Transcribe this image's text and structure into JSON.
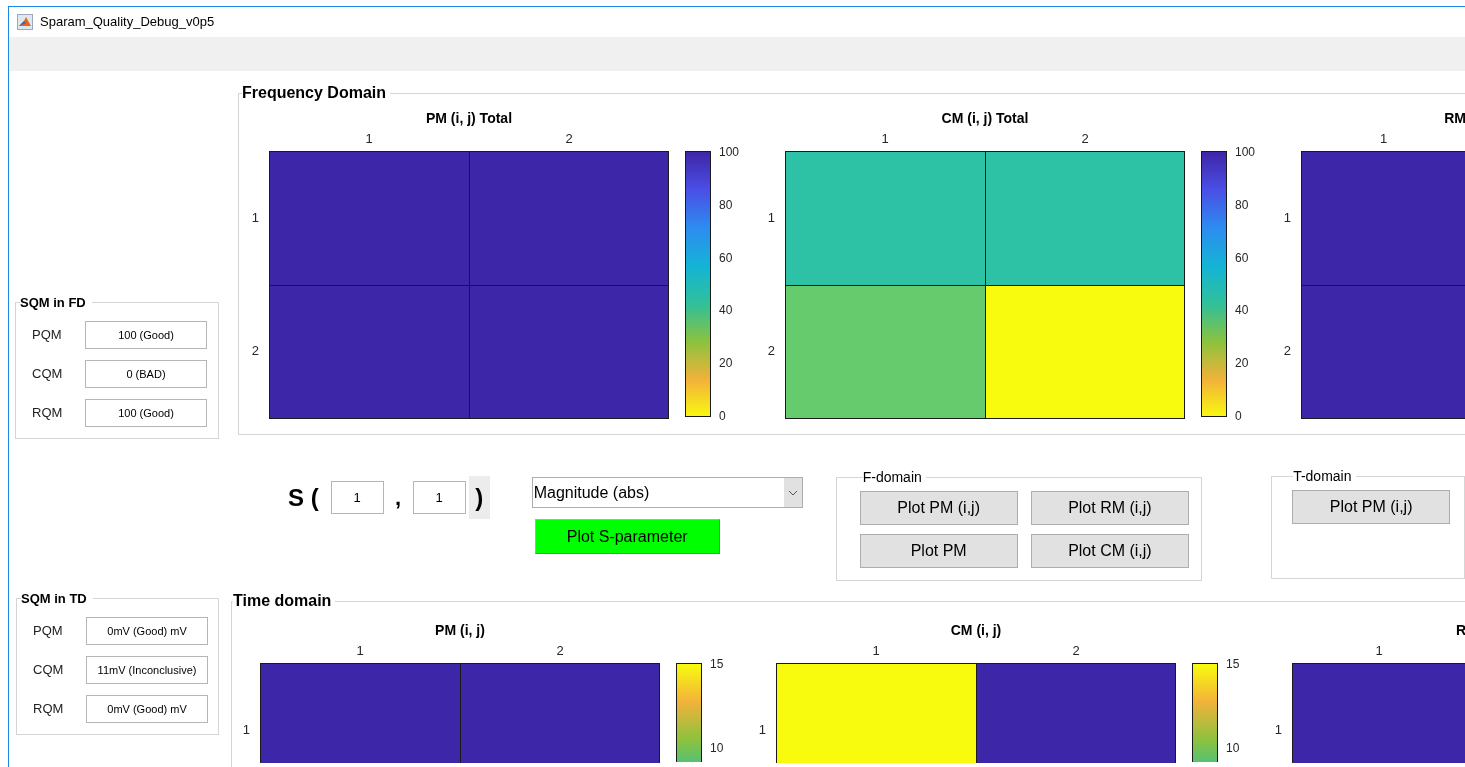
{
  "window": {
    "title": "Sparam_Quality_Debug_v0p5"
  },
  "sqm_fd": {
    "title": "SQM in FD",
    "rows": [
      {
        "label": "PQM",
        "value": "100 (Good)"
      },
      {
        "label": "CQM",
        "value": "0 (BAD)"
      },
      {
        "label": "RQM",
        "value": "100 (Good)"
      }
    ]
  },
  "frequency_domain": {
    "title": "Frequency Domain",
    "heatmaps": [
      {
        "title": "PM (i, j) Total",
        "columns": [
          "1",
          "2"
        ],
        "rows": [
          {
            "label": "1",
            "cells": [
              {
                "color": "#3e26a8"
              },
              {
                "color": "#3e26a8"
              }
            ]
          },
          {
            "label": "2",
            "cells": [
              {
                "color": "#3e26a8"
              },
              {
                "color": "#3e26a8"
              }
            ]
          }
        ],
        "colorbar": {
          "ascending": true,
          "ticks": [
            "100",
            "80",
            "60",
            "40",
            "20",
            "0"
          ]
        }
      },
      {
        "title": "CM (i, j) Total",
        "columns": [
          "1",
          "2"
        ],
        "rows": [
          {
            "label": "1",
            "cells": [
              {
                "color": "#2dc2a5"
              },
              {
                "color": "#2dc2a5"
              }
            ]
          },
          {
            "label": "2",
            "cells": [
              {
                "color": "#65cb6d"
              },
              {
                "color": "#f9fb0e"
              }
            ]
          }
        ],
        "colorbar": {
          "ascending": true,
          "ticks": [
            "100",
            "80",
            "60",
            "40",
            "20",
            "0"
          ]
        }
      },
      {
        "title": "RM",
        "columns": [
          "1"
        ],
        "rows": [
          {
            "label": "1",
            "cells": [
              {
                "color": "#3e26a8"
              }
            ]
          },
          {
            "label": "2",
            "cells": [
              {
                "color": "#3e26a8"
              }
            ]
          }
        ]
      }
    ]
  },
  "s_selector": {
    "label": "S (",
    "row": "1",
    "separator": ",",
    "column": "1",
    "close": ")"
  },
  "display": {
    "value": "Magnitude (abs)"
  },
  "plot_button": "Plot S-parameter",
  "f_domain": {
    "title": "F-domain",
    "buttons": [
      "Plot PM (i,j)",
      "Plot RM (i,j)",
      "Plot PM",
      "Plot CM (i,j)"
    ]
  },
  "t_domain": {
    "title": "T-domain",
    "buttons": [
      "Plot PM (i,j)"
    ]
  },
  "sqm_td": {
    "title": "SQM in TD",
    "rows": [
      {
        "label": "PQM",
        "value": "0mV (Good) mV"
      },
      {
        "label": "CQM",
        "value": "11mV (Inconclusive)"
      },
      {
        "label": "RQM",
        "value": "0mV (Good) mV"
      }
    ]
  },
  "time_domain": {
    "title": "Time domain",
    "heatmaps": [
      {
        "title": "PM (i, j)",
        "columns": [
          "1",
          "2"
        ],
        "rows": [
          {
            "label": "1",
            "cells": [
              {
                "color": "#3e26a8"
              },
              {
                "color": "#3e26a8"
              }
            ]
          }
        ],
        "colorbar": {
          "ascending": false,
          "ticks": [
            "15",
            "10"
          ]
        }
      },
      {
        "title": "CM (i, j)",
        "columns": [
          "1",
          "2"
        ],
        "rows": [
          {
            "label": "1",
            "cells": [
              {
                "color": "#f9fb0e"
              },
              {
                "color": "#3e26a8"
              }
            ]
          }
        ],
        "colorbar": {
          "ascending": false,
          "ticks": [
            "15",
            "10"
          ]
        }
      },
      {
        "title": "R",
        "columns": [
          "1"
        ],
        "rows": [
          {
            "label": "1",
            "cells": [
              {
                "color": "#3e26a8"
              }
            ]
          }
        ]
      }
    ]
  }
}
